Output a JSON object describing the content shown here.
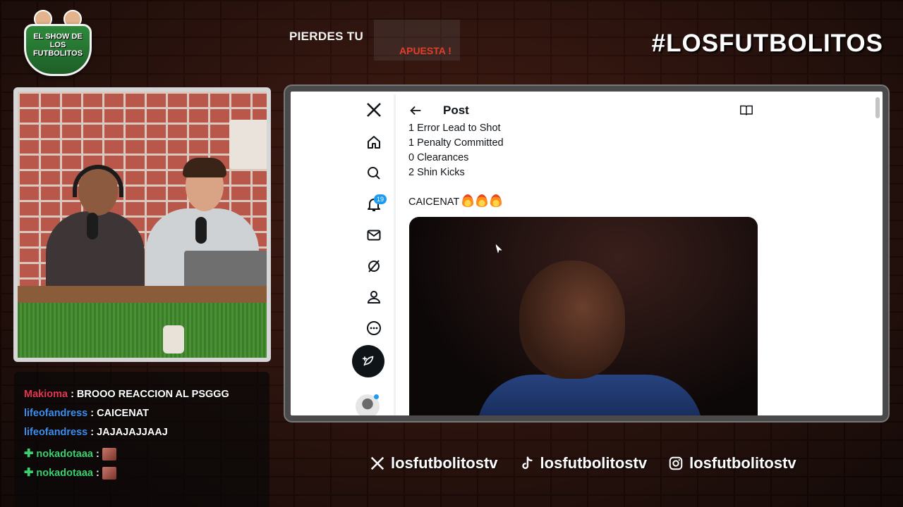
{
  "brand": {
    "logo_text": "EL SHOW DE LOS FUTBOLITOS",
    "hashtag": "#LOSFUTBOLITOS",
    "ticker_primary": "PIERDES TU",
    "ticker_secondary": "APUESTA !"
  },
  "chat": {
    "messages": [
      {
        "user": "Makioma",
        "user_color": "#e8344f",
        "text": ": BROOO REACCION AL PSGGG",
        "prefix_icon": ""
      },
      {
        "user": "lifeofandress",
        "user_color": "#3b8ff0",
        "text": ": CAICENAT",
        "prefix_icon": ""
      },
      {
        "user": "lifeofandress",
        "user_color": "#3b8ff0",
        "text": ": JAJAJAJJAAJ",
        "prefix_icon": ""
      },
      {
        "user": "nokadotaaa",
        "user_color": "#3bd16f",
        "text": ":",
        "prefix_icon": "plus-badge-icon"
      },
      {
        "user": "nokadotaaa",
        "user_color": "#3bd16f",
        "text": ":",
        "prefix_icon": "plus-badge-icon"
      }
    ]
  },
  "x_app": {
    "page_title": "Post",
    "notification_count": "19",
    "nav_icons": [
      "x-logo-icon",
      "home-icon",
      "search-icon",
      "bell-icon",
      "mail-icon",
      "grok-icon",
      "profile-icon",
      "more-icon",
      "compose-icon"
    ],
    "tweet_lines": [
      "1 Error Lead to Shot",
      "1 Penalty Committed",
      "0 Clearances",
      "2 Shin Kicks"
    ],
    "tweet_tagline": "CAICENAT",
    "fire_emoji_count": 3
  },
  "socials": [
    {
      "icon": "x-icon",
      "handle": "losfutbolitostv"
    },
    {
      "icon": "tiktok-icon",
      "handle": "losfutbolitostv"
    },
    {
      "icon": "instagram-icon",
      "handle": "losfutbolitostv"
    }
  ]
}
